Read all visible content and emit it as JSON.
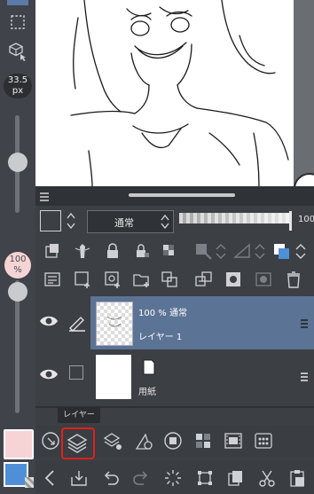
{
  "brush_size": {
    "value": "33.5",
    "unit": "px"
  },
  "opacity": {
    "value": "100",
    "unit": "%"
  },
  "panel": {
    "blend_mode": "通常",
    "right_edge_value": "100"
  },
  "layers": [
    {
      "opacity_mode": "100 % 通常",
      "name": "レイヤー 1",
      "selected": true
    },
    {
      "name": "用紙",
      "selected": false
    }
  ],
  "tooltip": "レイヤー",
  "colors": {
    "main_color": "#f6d4d6",
    "sub_color": "#4f8fd8",
    "selected_layer_bg": "#5b7394",
    "highlight_box": "#e0201f"
  }
}
